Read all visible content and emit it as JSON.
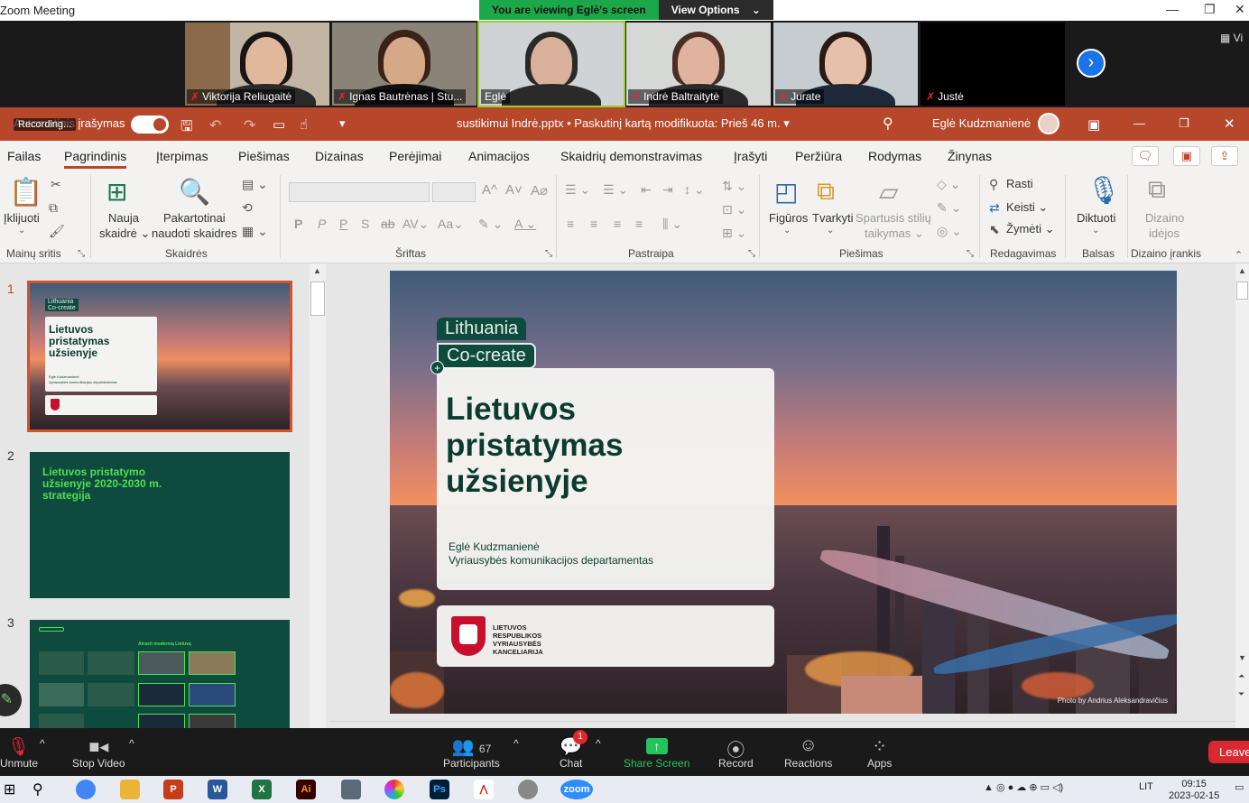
{
  "zoom": {
    "window_title": "Zoom Meeting",
    "viewing_banner": "You are viewing Eglė's screen",
    "view_options": "View Options",
    "view_btn": "Vi",
    "participants": [
      {
        "name": "Viktorija Reliugaitė",
        "muted": true
      },
      {
        "name": "Ignas Bautrėnas | Stu...",
        "muted": true
      },
      {
        "name": "Eglė",
        "muted": false
      },
      {
        "name": "Indrė Baltraitytė",
        "muted": true
      },
      {
        "name": "Jurate",
        "muted": true
      },
      {
        "name": "Justė",
        "muted": true
      }
    ],
    "bottom_bar": {
      "unmute": "Unmute",
      "stop_video": "Stop Video",
      "participants": "Participants",
      "participants_count": "67",
      "chat": "Chat",
      "chat_badge": "1",
      "share_screen": "Share Screen",
      "record": "Record",
      "reactions": "Reactions",
      "apps": "Apps",
      "leave": "Leave"
    }
  },
  "ppt": {
    "autosave_label": "Automatinis įrašymas",
    "recording_label": "Recording...",
    "file_title": "sustikimui Indrė.pptx • Paskutinį kartą modifikuota: Prieš 46 m.",
    "user_name": "Eglė Kudzmanienė",
    "tabs": [
      "Failas",
      "Pagrindinis",
      "Įterpimas",
      "Piešimas",
      "Dizainas",
      "Perėjimai",
      "Animacijos",
      "Skaidrių demonstravimas",
      "Įrašyti",
      "Peržiūra",
      "Rodymas",
      "Žinynas"
    ],
    "selected_tab": "Pagrindinis",
    "ribbon": {
      "paste": "Įklijuoti",
      "clipboard_group": "Mainų sritis",
      "new_slide_1": "Nauja",
      "new_slide_2": "skaidrė",
      "reuse_1": "Pakartotinai",
      "reuse_2": "naudoti skaidres",
      "slides_group": "Skaidrės",
      "font_group": "Šriftas",
      "paragraph_group": "Pastraipa",
      "shapes": "Figūros",
      "arrange": "Tvarkyti",
      "quick_styles_1": "Spartusis stilių",
      "quick_styles_2": "taikymas",
      "drawing_group": "Piešimas",
      "find": "Rasti",
      "replace": "Keisti",
      "select": "Žymėti",
      "editing_group": "Redagavimas",
      "dictate": "Diktuoti",
      "voice_group": "Balsas",
      "designer_1": "Dizaino",
      "designer_2": "idėjos",
      "designer_group": "Dizaino įrankis"
    },
    "thumbnails": [
      {
        "num": "1",
        "title": "Lietuvos pristatymas užsienyje",
        "author": "Eglė Kudzmanienė",
        "dept": "Vyriausybės komunikacijos departamentas"
      },
      {
        "num": "2",
        "title": "Lietuvos pristatymo užsienyje 2020-2030 m. strategija"
      },
      {
        "num": "3",
        "title": "Atrasti modernią Lietuvą"
      }
    ],
    "slide": {
      "badge_1": "Lithuania",
      "badge_2": "Co-create",
      "title": "Lietuvos pristatymas užsienyje",
      "author": "Eglė Kudzmanienė",
      "department": "Vyriausybės komunikacijos departamentas",
      "logo_text": "LIETUVOS RESPUBLIKOS VYRIAUSYBĖS KANCELIARIJA",
      "photo_credit": "Photo by Andrius Aleksandravičius"
    }
  },
  "taskbar": {
    "lang": "LIT",
    "time": "09:15",
    "date": "2023-02-15"
  },
  "colors": {
    "ppt_red": "#b7472a",
    "slide_green": "#0e4a3e",
    "zoom_green": "#22c45b"
  }
}
